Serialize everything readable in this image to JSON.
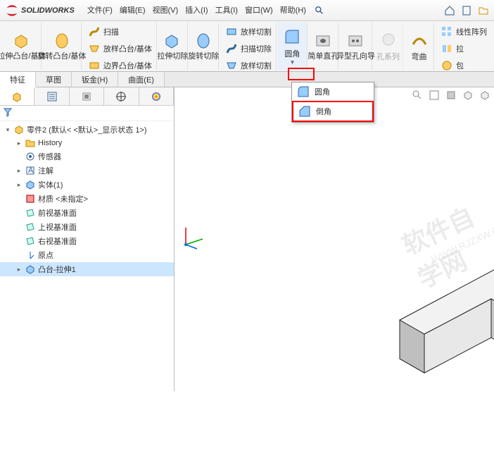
{
  "app": {
    "name": "SOLIDWORKS"
  },
  "menu": {
    "file": "文件(F)",
    "edit": "编辑(E)",
    "view": "视图(V)",
    "insert": "插入(I)",
    "tools": "工具(I)",
    "window": "窗口(W)",
    "help": "帮助(H)"
  },
  "ribbon": {
    "extrude": "拉伸凸台/基体",
    "revolve": "旋转凸台/基体",
    "sweep": "扫描",
    "loft": "放样凸台/基体",
    "boundary": "边界凸台/基体",
    "cutext": "拉伸切除",
    "cutrev": "旋转切除",
    "loftcut": "放样切割",
    "sweepcut": "扫描切除",
    "loftcut2": "放样切割",
    "fillet": "圆角",
    "simplehole": "简单直孔",
    "wizardhole": "异型孔向导",
    "holeser": "孔系列",
    "bend": "弯曲",
    "linpat": "线性阵列",
    "mirror": "拉",
    "more": "包"
  },
  "tabs": {
    "feat": "特征",
    "sketch": "草图",
    "sheet": "钣金(H)",
    "surface": "曲面(E)"
  },
  "dropdown": {
    "fillet": "圆角",
    "chamfer": "倒角"
  },
  "tree": {
    "root": "零件2  (默认< <默认>_显示状态 1>)",
    "history": "History",
    "sensors": "传感器",
    "notes": "注解",
    "solids": "实体(1)",
    "material": "材质 <未指定>",
    "front": "前视基准面",
    "top": "上视基准面",
    "right": "右视基准面",
    "origin": "原点",
    "feat1": "凸台-拉伸1"
  },
  "watermark": {
    "t1": "软件自学网",
    "t2": "WWW.RJZXW.COM"
  }
}
